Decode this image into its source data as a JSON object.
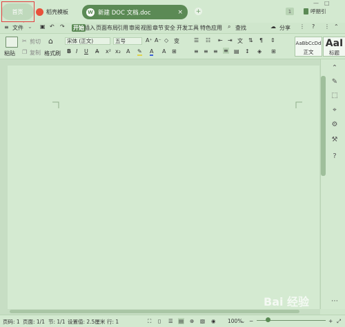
{
  "titlebar": {
    "home_tab": "首页",
    "template_tab": "稻壳模板",
    "doc_tab": {
      "icon_letter": "W",
      "title": "新建 DOC 文档.doc",
      "close": "×"
    },
    "new_tab": "+",
    "badge": "1",
    "user_label": "呼朋引",
    "window_controls": [
      "—",
      "□"
    ]
  },
  "menubar": {
    "file_menu": "文件",
    "items": [
      "开始",
      "插入",
      "页面布局",
      "引用",
      "审阅",
      "视图",
      "章节",
      "安全",
      "开发工具",
      "特色应用"
    ],
    "active_item": "开始",
    "search": "查找",
    "share": "分享"
  },
  "ribbon": {
    "paste": "粘贴",
    "cut": "剪切",
    "copy": "复制",
    "format_painter": "格式刷",
    "font_name": "宋体 (正文)",
    "font_size": "五号",
    "bold": "B",
    "italic": "I",
    "underline": "U",
    "styles": [
      {
        "preview": "AaBbCcDd",
        "name": "正文"
      },
      {
        "preview": "AaI",
        "name": "标题"
      }
    ]
  },
  "statusbar": {
    "page_num": "页码: 1",
    "pages": "页面: 1/1",
    "section": "节: 1/1",
    "setting": "设置值: 2.5厘米",
    "column": "行: 1",
    "zoom": "100%"
  },
  "watermark": "Bai 经验",
  "colors": {
    "accent": "#5b8a55",
    "background": "#cfe6cc",
    "annotation": "#e23b3b"
  }
}
